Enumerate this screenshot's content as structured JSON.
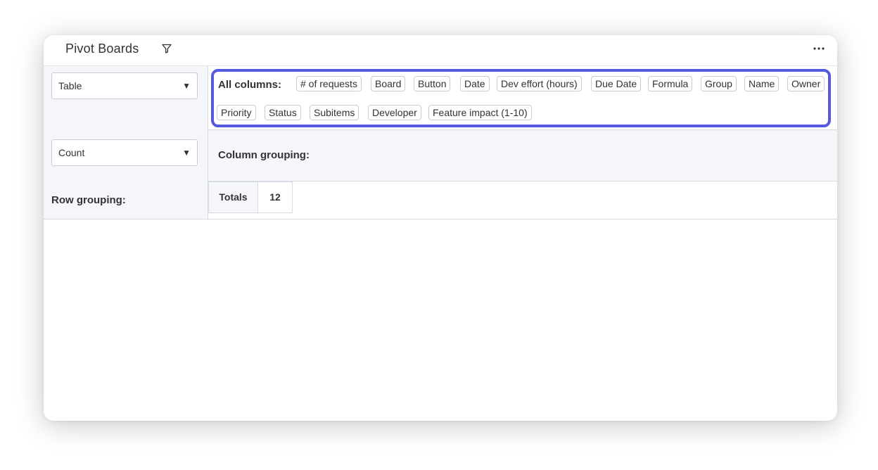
{
  "widget": {
    "title": "Pivot Boards",
    "icons": {
      "filter": "filter-icon",
      "more": "more-options-icon"
    }
  },
  "controls": {
    "view_type": {
      "value": "Table"
    },
    "aggregation": {
      "value": "Count"
    }
  },
  "columns": {
    "label": "All columns:",
    "items": [
      "# of requests",
      "Board",
      "Button",
      "Date",
      "Dev effort (hours)",
      "Due Date",
      "Formula",
      "Group",
      "Name",
      "Owner",
      "Priority",
      "Status",
      "Subitems",
      "Developer",
      "Feature impact (1-10)"
    ]
  },
  "column_grouping": {
    "label": "Column grouping:"
  },
  "row_grouping": {
    "label": "Row grouping:"
  },
  "totals": {
    "label": "Totals",
    "value": "12"
  },
  "colors": {
    "highlight_border": "#5559df",
    "panel_bg": "#f5f6fa",
    "text": "#323338",
    "border": "#d8dbe3"
  }
}
